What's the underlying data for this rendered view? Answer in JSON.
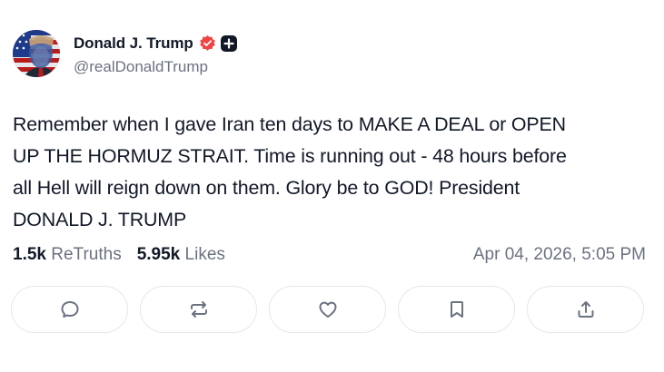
{
  "post": {
    "author": {
      "display_name": "Donald J. Trump",
      "handle": "@realDonaldTrump",
      "verified_icon": "verified-badge-icon",
      "plus_icon": "plus-badge-icon",
      "verified_color": "#ef4444"
    },
    "text": "Remember when I gave Iran ten days to MAKE A DEAL or OPEN\nUP THE HORMUZ STRAIT. Time is running out - 48 hours before\nall Hell will reign down on them. Glory be to GOD! President\nDONALD J. TRUMP",
    "stats": {
      "retruths_count": "1.5k",
      "retruths_label": "ReTruths",
      "likes_count": "5.95k",
      "likes_label": "Likes"
    },
    "timestamp": "Apr 04, 2026, 5:05 PM",
    "actions": [
      {
        "name": "reply",
        "icon": "speech-bubble-icon"
      },
      {
        "name": "retruth",
        "icon": "repost-arrows-icon"
      },
      {
        "name": "like",
        "icon": "heart-icon"
      },
      {
        "name": "bookmark",
        "icon": "bookmark-icon"
      },
      {
        "name": "share",
        "icon": "share-upload-icon"
      }
    ]
  }
}
